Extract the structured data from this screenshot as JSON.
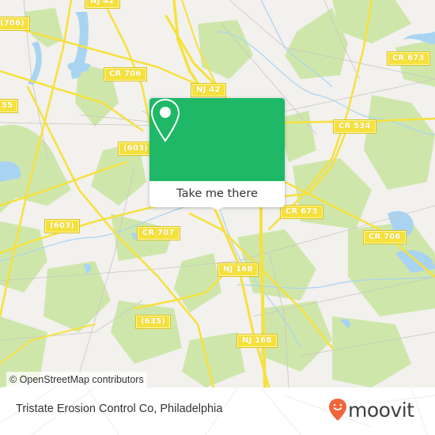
{
  "map": {
    "attribution": "© OpenStreetMap contributors",
    "colors": {
      "land": "#f2f1ee",
      "forest": "#cfe6ab",
      "water": "#a9d4f1",
      "road_major": "#f6e13c",
      "road_minor": "#c9c9c9",
      "label_bg": "#f6e13c"
    },
    "road_labels": [
      {
        "id": "nj42-top",
        "text": "NJ 42"
      },
      {
        "id": "cr706-edge",
        "text": "(706)"
      },
      {
        "id": "cr706",
        "text": "CR 706"
      },
      {
        "id": "nj42",
        "text": "NJ 42"
      },
      {
        "id": "r55",
        "text": "55"
      },
      {
        "id": "cr673-top",
        "text": "CR 673"
      },
      {
        "id": "cr534",
        "text": "CR 534"
      },
      {
        "id": "r603-a",
        "text": "(603)"
      },
      {
        "id": "r603-b",
        "text": "(603)"
      },
      {
        "id": "cr707",
        "text": "CR 707"
      },
      {
        "id": "cr673",
        "text": "CR 673"
      },
      {
        "id": "cr706-right",
        "text": "CR 706"
      },
      {
        "id": "nj168-a",
        "text": "NJ 168"
      },
      {
        "id": "r635",
        "text": "(635)"
      },
      {
        "id": "nj168-b",
        "text": "NJ 168"
      }
    ]
  },
  "popup": {
    "icon": "map-pin-icon",
    "button_label": "Take me there",
    "color": "#1fb866"
  },
  "footer": {
    "place_name": "Tristate Erosion Control Co, Philadelphia",
    "brand": "moovit",
    "brand_icon": "moovit-smiley-pin-icon",
    "brand_color": "#f0653a"
  }
}
